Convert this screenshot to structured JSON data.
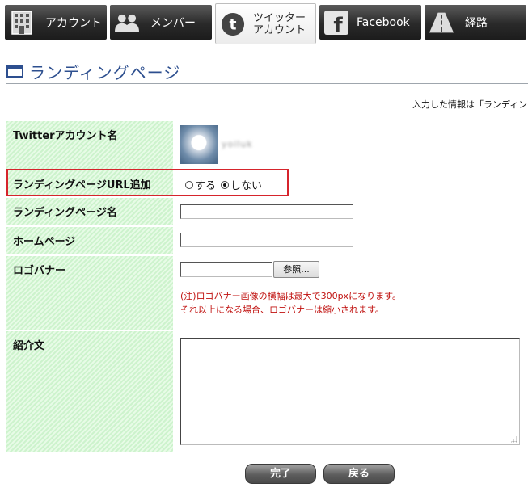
{
  "tabs": [
    {
      "label": "アカウント",
      "icon": "building-icon"
    },
    {
      "label": "メンバー",
      "icon": "people-icon"
    },
    {
      "label": "ツイッター\nアカウント",
      "icon": "twitter-icon",
      "active": true
    },
    {
      "label": "Facebook",
      "icon": "facebook-icon"
    },
    {
      "label": "経路",
      "icon": "road-icon"
    }
  ],
  "header": {
    "title": "ランディングページ",
    "notice": "入力した情報は「ランディング"
  },
  "form": {
    "twitter_account_label": "Twitterアカウント名",
    "twitter_username": "yoiluk",
    "url_add_label": "ランディングページURL追加",
    "radio_yes": "する",
    "radio_no": "しない",
    "radio_selected": "しない",
    "page_name_label": "ランディングページ名",
    "page_name_value": "",
    "homepage_label": "ホームページ",
    "homepage_value": "",
    "logo_label": "ロゴバナー",
    "logo_value": "",
    "browse_label": "参照...",
    "logo_note_1": "(注)ロゴバナー画像の横幅は最大で300pxになります。",
    "logo_note_2": "それ以上になる場合、ロゴバナーは縮小されます。",
    "intro_label": "紹介文",
    "intro_value": ""
  },
  "actions": {
    "done_label": "完了",
    "back_label": "戻る"
  },
  "colors": {
    "title_blue": "#2d4f8f",
    "highlight_red": "#d6242c",
    "note_red": "#c0110f",
    "label_green": "#cdf3cd"
  }
}
